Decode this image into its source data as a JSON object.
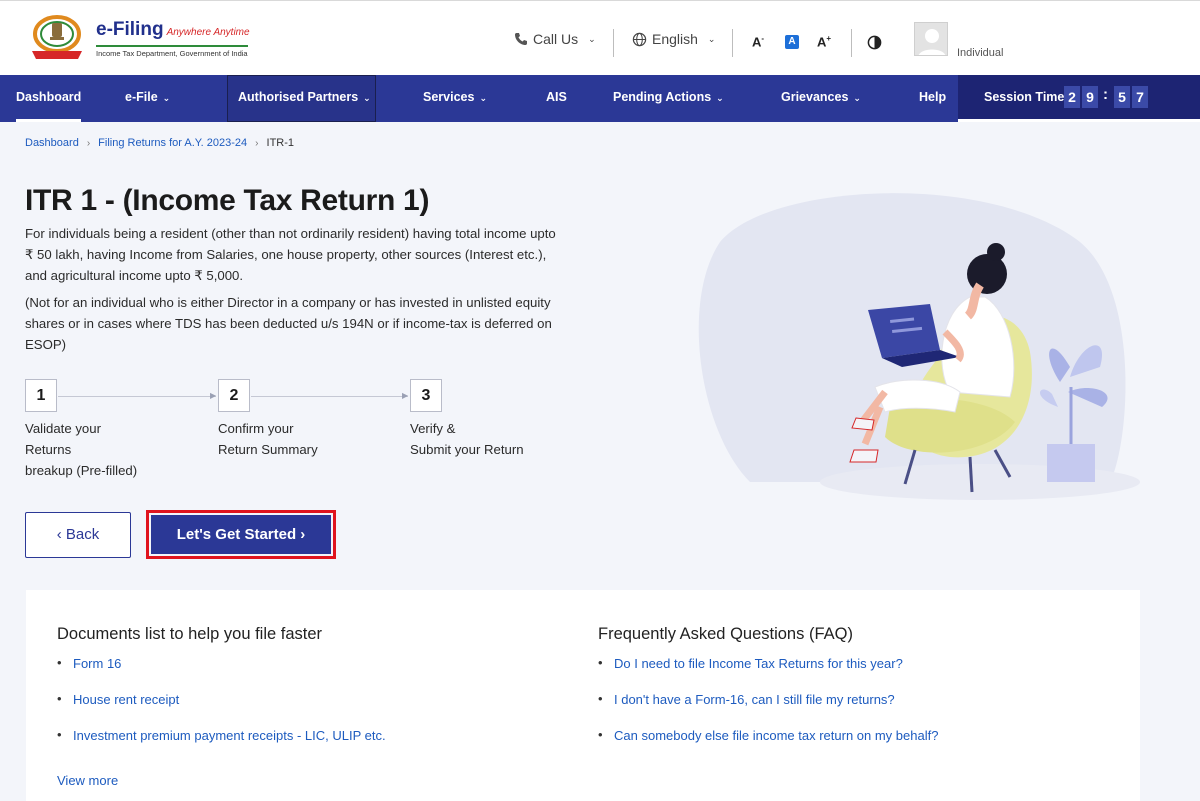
{
  "header": {
    "brand": "e-Filing",
    "brand_tagline": "Anywhere Anytime",
    "brand_subtitle": "Income Tax Department, Government of India",
    "call_us": "Call Us",
    "language": "English",
    "font_decrease": "A",
    "font_default": "A",
    "font_increase": "A",
    "user_type": "Individual"
  },
  "nav": {
    "items": [
      {
        "label": "Dashboard",
        "dropdown": false
      },
      {
        "label": "e-File",
        "dropdown": true
      },
      {
        "label": "Authorised Partners",
        "dropdown": true
      },
      {
        "label": "Services",
        "dropdown": true
      },
      {
        "label": "AIS",
        "dropdown": false
      },
      {
        "label": "Pending Actions",
        "dropdown": true
      },
      {
        "label": "Grievances",
        "dropdown": true
      },
      {
        "label": "Help",
        "dropdown": false
      }
    ],
    "caret": "⌄",
    "session_label": "Session Time",
    "session_digits": [
      "2",
      "9",
      "5",
      "7"
    ],
    "session_colon": ":"
  },
  "breadcrumb": {
    "items": [
      "Dashboard",
      "Filing Returns for A.Y. 2023-24",
      "ITR-1"
    ],
    "separator": "›"
  },
  "main": {
    "title": "ITR 1 - (Income Tax Return 1)",
    "description": "For individuals being a resident (other than not ordinarily resident) having total income upto ₹ 50 lakh, having Income from Salaries, one house property, other sources (Interest etc.), and agricultural income upto ₹ 5,000.",
    "note": "(Not for an individual who is either Director in a company or has invested in unlisted equity shares or in cases where TDS has been deducted u/s 194N or if income-tax is deferred on ESOP)",
    "steps": [
      {
        "number": "1",
        "line1": "Validate your",
        "line2": "Returns",
        "line3": "breakup (Pre-filled)"
      },
      {
        "number": "2",
        "line1": "Confirm your",
        "line2": "Return Summary",
        "line3": ""
      },
      {
        "number": "3",
        "line1": "Verify &",
        "line2": "Submit your Return",
        "line3": ""
      }
    ],
    "back_label": "‹  Back",
    "start_label": "Let's Get Started  ›"
  },
  "documents": {
    "title": "Documents list to help you file faster",
    "items": [
      "Form 16",
      "House rent receipt",
      "Investment premium payment receipts - LIC, ULIP etc."
    ],
    "view_more": "View more"
  },
  "faq": {
    "title": "Frequently Asked Questions (FAQ)",
    "items": [
      "Do I need to file Income Tax Returns for this year?",
      "I don't have a Form-16, can I still file my returns?",
      "Can somebody else file income tax return on my behalf?"
    ]
  },
  "colors": {
    "primary": "#2b3896",
    "session_bg": "#1d2473",
    "link": "#1d5bbf",
    "highlight": "#e0141e",
    "page_bg": "#f3f5fa"
  }
}
